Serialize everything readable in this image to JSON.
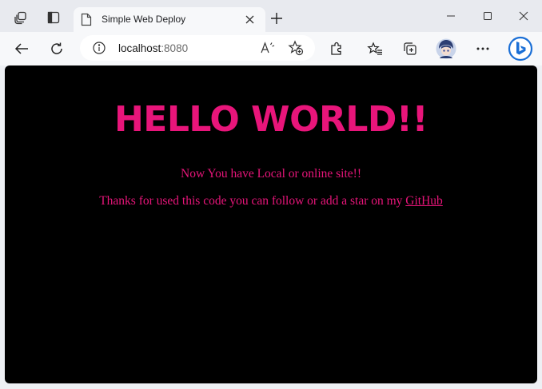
{
  "browser": {
    "tab": {
      "title": "Simple Web Deploy"
    },
    "address": {
      "host": "localhost",
      "port": ":8080"
    },
    "icons": {
      "workspaces": "workspaces-icon",
      "tab_actions": "tab-actions-icon",
      "page": "page-icon",
      "close_tab": "close-icon",
      "new_tab": "plus-icon",
      "minimize": "minimize-icon",
      "maximize": "maximize-icon",
      "close_window": "close-window-icon",
      "back": "back-arrow-icon",
      "refresh": "refresh-icon",
      "info": "info-icon",
      "read_aloud": "read-aloud-icon",
      "favorite": "add-favorite-icon",
      "extensions": "extensions-icon",
      "favorites": "favorites-icon",
      "collections": "collections-icon",
      "profile": "avatar",
      "more": "more-icon",
      "copilot": "bing-icon"
    },
    "colors": {
      "accent": "#1b6fd6",
      "tabstrip": "#e8eaef",
      "toolbar": "#f7f8fa"
    }
  },
  "page": {
    "heading": "HELLO WORLD!!",
    "line1": "Now You have Local or online site!!",
    "line2_prefix": "Thanks for used this code you can follow or add a star on my ",
    "line2_link": "GitHub",
    "colors": {
      "background": "#000000",
      "text": "#e8157a"
    }
  }
}
